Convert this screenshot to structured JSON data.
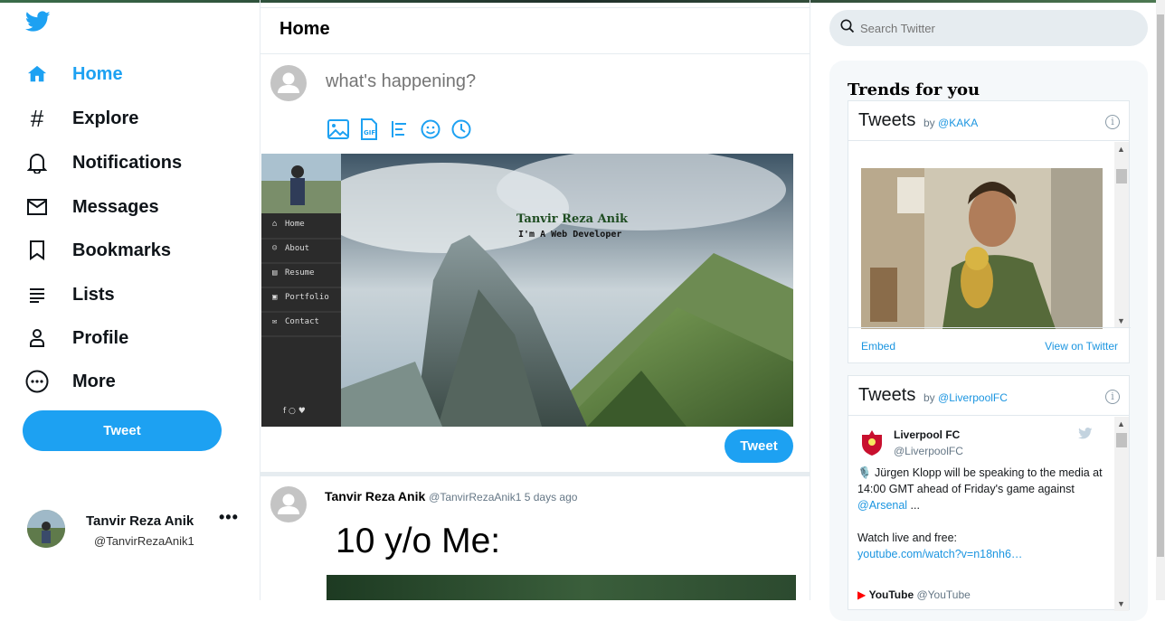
{
  "app": {
    "brand_color": "#1da1f2"
  },
  "sidebar": {
    "logo": "twitter-bird-icon",
    "items": [
      {
        "label": "Home",
        "icon": "home-icon",
        "active": true
      },
      {
        "label": "Explore",
        "icon": "hashtag-icon"
      },
      {
        "label": "Notifications",
        "icon": "bell-icon"
      },
      {
        "label": "Messages",
        "icon": "envelope-icon"
      },
      {
        "label": "Bookmarks",
        "icon": "bookmark-icon"
      },
      {
        "label": "Lists",
        "icon": "list-icon"
      },
      {
        "label": "Profile",
        "icon": "person-icon"
      },
      {
        "label": "More",
        "icon": "more-circle-icon"
      }
    ],
    "tweet_button": "Tweet",
    "user": {
      "name": "Tanvir Reza Anik",
      "handle": "@TanvirRezaAnik1",
      "more": "•••"
    }
  },
  "main": {
    "title": "Home",
    "compose": {
      "placeholder": "what's happening?",
      "icons": [
        "image-icon",
        "gif-icon",
        "poll-icon",
        "emoji-icon",
        "schedule-icon"
      ],
      "submit": "Tweet",
      "media": {
        "site_name": "Tanvir Reza Anik",
        "site_tagline": "I'm A Web Developer",
        "site_nav": [
          "Home",
          "About",
          "Resume",
          "Portfolio",
          "Contact"
        ]
      }
    },
    "post": {
      "name": "Tanvir Reza Anik",
      "handle_time": "@TanvirRezaAnik1 5 days ago",
      "text": "10 y/o Me:"
    }
  },
  "right": {
    "search": {
      "placeholder": "Search Twitter"
    },
    "trends_title": "Trends for you",
    "embeds": [
      {
        "title": "Tweets",
        "by": "by",
        "account": "@KAKA",
        "footer_left": "Embed",
        "footer_right": "View on Twitter"
      },
      {
        "title": "Tweets",
        "by": "by",
        "account": "@LiverpoolFC",
        "tweet": {
          "name": "Liverpool FC",
          "handle": "@LiverpoolFC",
          "line1": "🎙️ Jürgen Klopp will be speaking to the media at 14:00 GMT ahead of Friday's game against",
          "mention": "@Arsenal",
          "ellipsis": " ...",
          "line2": "Watch live and free:",
          "link": "youtube.com/watch?v=n18nh6…",
          "next_name": "YouTube",
          "next_handle": "@YouTube"
        }
      }
    ]
  }
}
